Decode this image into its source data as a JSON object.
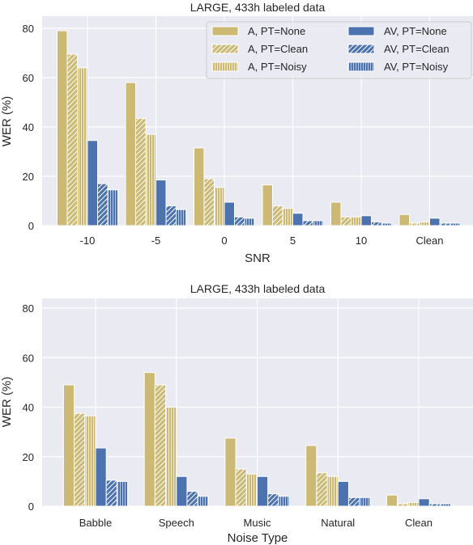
{
  "colors": {
    "audio": "#ccb974",
    "audiovisual": "#4c72b0",
    "plot_bg": "#eaeaf2",
    "grid": "#ffffff"
  },
  "chart_data": [
    {
      "type": "bar",
      "title": "LARGE, 433h labeled data",
      "xlabel": "SNR",
      "ylabel": "WER (%)",
      "ylim": [
        0,
        84
      ],
      "yticks": [
        0,
        20,
        40,
        60,
        80
      ],
      "grid": true,
      "legend_position": "top-right",
      "categories": [
        "-10",
        "-5",
        "0",
        "5",
        "10",
        "Clean"
      ],
      "series": [
        {
          "name": "A, PT=None",
          "modality": "audio",
          "hatch": "none",
          "values": [
            79,
            58,
            31.5,
            16.5,
            9.5,
            4.5
          ]
        },
        {
          "name": "A, PT=Clean",
          "modality": "audio",
          "hatch": "diagonal",
          "values": [
            69.5,
            43.5,
            19,
            8,
            3.5,
            1
          ]
        },
        {
          "name": "A, PT=Noisy",
          "modality": "audio",
          "hatch": "vertical",
          "values": [
            64,
            37,
            15.5,
            7,
            3.5,
            1.5
          ]
        },
        {
          "name": "AV, PT=None",
          "modality": "audiovisual",
          "hatch": "none",
          "values": [
            34.5,
            18.5,
            9.5,
            5,
            4,
            3
          ]
        },
        {
          "name": "AV, PT=Clean",
          "modality": "audiovisual",
          "hatch": "diagonal",
          "values": [
            17,
            8,
            3.5,
            2,
            1.5,
            1
          ]
        },
        {
          "name": "AV, PT=Noisy",
          "modality": "audiovisual",
          "hatch": "vertical",
          "values": [
            14.5,
            6.5,
            3,
            2,
            1,
            1
          ]
        }
      ]
    },
    {
      "type": "bar",
      "title": "LARGE, 433h labeled data",
      "xlabel": "Noise Type",
      "ylabel": "WER (%)",
      "ylim": [
        0,
        84
      ],
      "yticks": [
        0,
        20,
        40,
        60,
        80
      ],
      "grid": true,
      "legend_position": "none",
      "categories": [
        "Babble",
        "Speech",
        "Music",
        "Natural",
        "Clean"
      ],
      "series": [
        {
          "name": "A, PT=None",
          "modality": "audio",
          "hatch": "none",
          "values": [
            49,
            54,
            27.5,
            24.5,
            4.5
          ]
        },
        {
          "name": "A, PT=Clean",
          "modality": "audio",
          "hatch": "diagonal",
          "values": [
            37.5,
            49,
            15,
            13.5,
            1
          ]
        },
        {
          "name": "A, PT=Noisy",
          "modality": "audio",
          "hatch": "vertical",
          "values": [
            36.5,
            40,
            13,
            12,
            1.5
          ]
        },
        {
          "name": "AV, PT=None",
          "modality": "audiovisual",
          "hatch": "none",
          "values": [
            23.5,
            12,
            12,
            10,
            3
          ]
        },
        {
          "name": "AV, PT=Clean",
          "modality": "audiovisual",
          "hatch": "diagonal",
          "values": [
            10.5,
            6,
            5,
            3.5,
            1
          ]
        },
        {
          "name": "AV, PT=Noisy",
          "modality": "audiovisual",
          "hatch": "vertical",
          "values": [
            10,
            4,
            4,
            3.5,
            1
          ]
        }
      ]
    }
  ]
}
